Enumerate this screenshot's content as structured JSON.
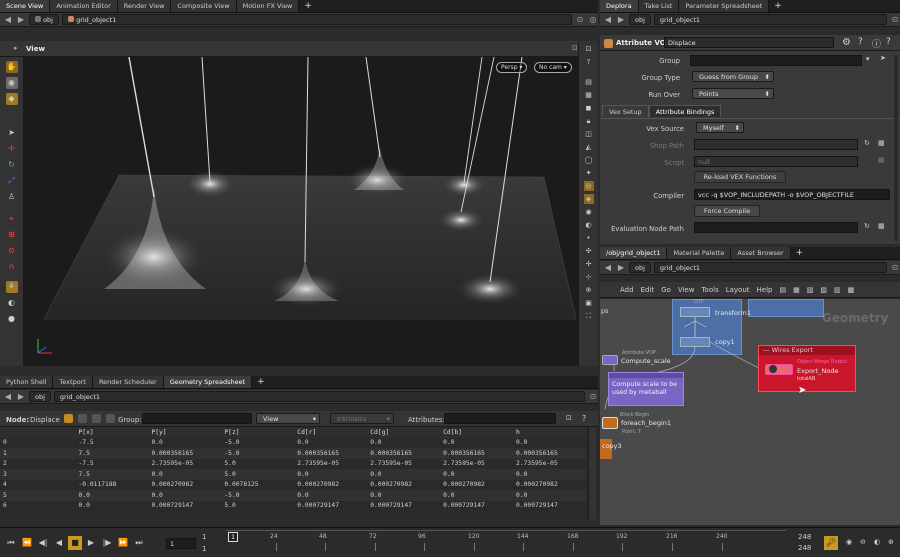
{
  "scene_tabs": [
    "Scene View",
    "Animation Editor",
    "Render View",
    "Composite View",
    "Motion FX View"
  ],
  "scene_path": {
    "root": "obj",
    "node": "grid_object1"
  },
  "viewport": {
    "title": "View",
    "persp_label": "Persp",
    "cam_label": "No cam",
    "colors": {
      "bg": "#1c1c1c",
      "grid": "#2a2a2a"
    }
  },
  "right_tabs": [
    "Deplora",
    "Take List",
    "Parameter Spreadsheet"
  ],
  "param_path": {
    "root": "obj",
    "node": "grid_object1"
  },
  "param_header": {
    "type": "Attribute VOP",
    "name": "Displace"
  },
  "params": {
    "group_label": "Group",
    "group_value": "",
    "group_type_label": "Group Type",
    "group_type_value": "Guess from Group",
    "run_over_label": "Run Over",
    "run_over_value": "Points",
    "subtabs": [
      "Vex Setup",
      "Attribute Bindings"
    ],
    "vex_source_label": "Vex Source",
    "vex_source_value": "Myself",
    "shop_path_label": "Shop Path",
    "script_label": "Script",
    "script_value": "null",
    "reload_label": "Re-load VEX Functions",
    "compiler_label": "Compiler",
    "compiler_value": "vcc -q $VOP_INCLUDEPATH -o $VOP_OBJECTFILE",
    "force_compile_label": "Force Compile",
    "eval_path_label": "Evaluation Node Path"
  },
  "net_tabs": [
    "/obj/grid_object1",
    "Material Palette",
    "Asset Browser"
  ],
  "net_path": {
    "root": "obj",
    "node": "grid_object1"
  },
  "net_menu": [
    "Add",
    "Edit",
    "Go",
    "View",
    "Tools",
    "Layout",
    "Help"
  ],
  "network": {
    "context_label": "Geometry",
    "nodes": {
      "transform": "transform1",
      "copy1": "copy1",
      "compute_scale_type": "Attribute VOP",
      "compute_scale": "Compute_scale",
      "note_text": "Compute scale to be used by metaball",
      "wires_export_title": "Wires Export",
      "export_type": "Object Merge Output",
      "export_node": "Export_Node",
      "export_sub": "totalAB",
      "foreach_type": "Block Begin",
      "foreach": "foreach_begin1",
      "foreach_sub": "Point: 7",
      "copy3": "copy3",
      "top_left_fragment": "ps",
      "vop_fragment": "DTF"
    },
    "colors": {
      "blue": "#4d6fa8",
      "purple": "#7a65c4",
      "red": "#c8172a",
      "orange": "#c26a1e"
    }
  },
  "bottom_tabs": [
    "Python Shell",
    "Textport",
    "Render Scheduler",
    "Geometry Spreadsheet"
  ],
  "sheet_path": {
    "root": "obj",
    "node": "grid_object1"
  },
  "sheet_toolbar": {
    "node_label": "Node:",
    "node_value": "Displace",
    "group_label": "Group:",
    "view_label": "View",
    "intrinsics_label": "Intrinsics",
    "attributes_label": "Attributes:"
  },
  "sheet": {
    "columns": [
      "",
      "P[x]",
      "P[y]",
      "P[z]",
      "Cd[r]",
      "Cd[g]",
      "Cd[b]",
      "h"
    ],
    "rows": [
      [
        "0",
        "-7.5",
        "0.0",
        "-5.0",
        "0.0",
        "0.0",
        "0.0",
        "0.0"
      ],
      [
        "1",
        "7.5",
        "0.000356165",
        "-5.0",
        "0.000356165",
        "0.000356165",
        "0.000356165",
        "0.000356165"
      ],
      [
        "2",
        "-7.5",
        "2.73595e-05",
        "5.0",
        "2.73595e-05",
        "2.73595e-05",
        "2.73595e-05",
        "2.73595e-05"
      ],
      [
        "3",
        "7.5",
        "0.0",
        "5.0",
        "0.0",
        "0.0",
        "0.0",
        "0.0"
      ],
      [
        "4",
        "-0.0117188",
        "0.000270982",
        "0.0078125",
        "0.000270982",
        "0.000270982",
        "0.000270982",
        "0.000270982"
      ],
      [
        "5",
        "0.0",
        "0.0",
        "-5.0",
        "0.0",
        "0.0",
        "0.0",
        "0.0"
      ],
      [
        "6",
        "0.0",
        "0.000729147",
        "5.0",
        "0.000729147",
        "0.000729147",
        "0.000729147",
        "0.000729147"
      ]
    ]
  },
  "timeline": {
    "start_frame": "1",
    "range_start": "1",
    "current_frame": "1",
    "ticks": [
      "24",
      "48",
      "72",
      "96",
      "120",
      "144",
      "168",
      "192",
      "216",
      "240"
    ],
    "end_frame": "248",
    "range_end": "248"
  }
}
